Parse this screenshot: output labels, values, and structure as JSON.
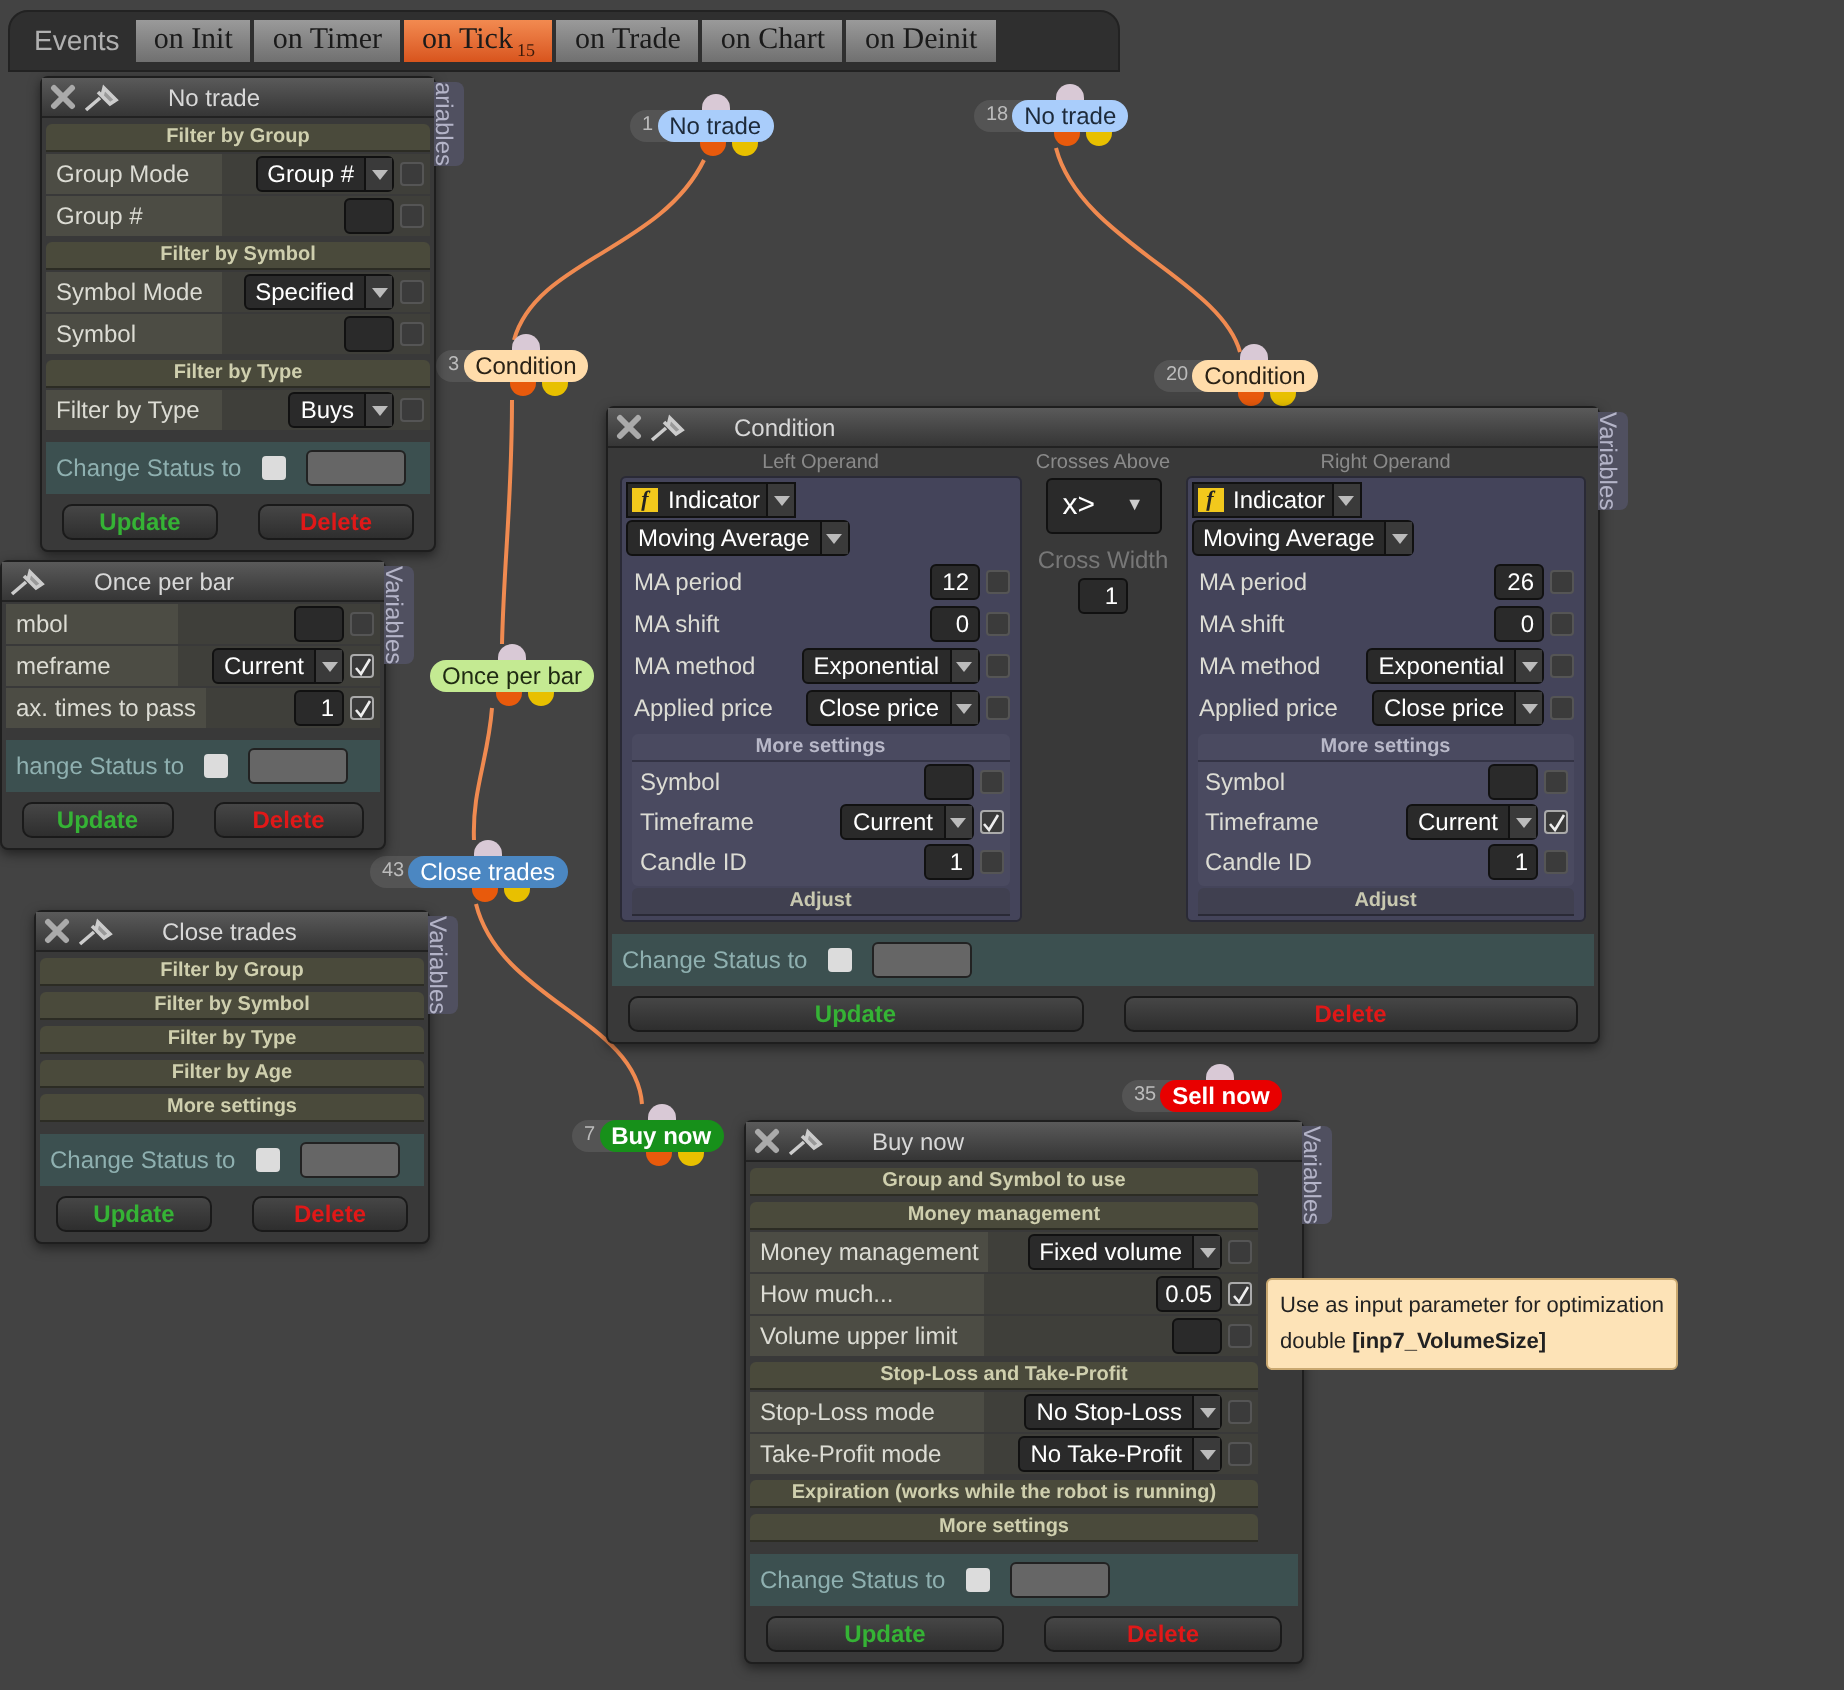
{
  "tab_bar": {
    "label": "Events",
    "tabs": [
      {
        "label": "on Init",
        "selected": false
      },
      {
        "label": "on Timer",
        "selected": false
      },
      {
        "label": "on Tick",
        "selected": true,
        "badge": "15"
      },
      {
        "label": "on Trade",
        "selected": false
      },
      {
        "label": "on Chart",
        "selected": false
      },
      {
        "label": "on Deinit",
        "selected": false
      }
    ]
  },
  "nodes": [
    {
      "number": "1",
      "label": "No trade",
      "kind": "no_trade"
    },
    {
      "number": "18",
      "label": "No trade",
      "kind": "no_trade"
    },
    {
      "number": "3",
      "label": "Condition",
      "kind": "condition"
    },
    {
      "number": "20",
      "label": "Condition",
      "kind": "condition"
    },
    {
      "label": "Once per bar",
      "kind": "once_per_bar"
    },
    {
      "number": "43",
      "label": "Close trades",
      "kind": "close_trades"
    },
    {
      "number": "7",
      "label": "Buy now",
      "kind": "buy"
    },
    {
      "number": "35",
      "label": "Sell now",
      "kind": "sell"
    }
  ],
  "panels": [
    {
      "kind": "form",
      "title": "No trade",
      "close_visible": true,
      "variables": "ariables",
      "rows": [
        {
          "kind": "section",
          "label": "Filter by Group"
        },
        {
          "kind": "select",
          "label": "Group Mode",
          "value": "Group #",
          "checked": false
        },
        {
          "kind": "input",
          "label": "Group #",
          "checked": false
        },
        {
          "kind": "section",
          "label": "Filter by Symbol"
        },
        {
          "kind": "select",
          "label": "Symbol Mode",
          "value": "Specified",
          "checked": false
        },
        {
          "kind": "input",
          "label": "Symbol",
          "checked": false
        },
        {
          "kind": "section",
          "label": "Filter by Type"
        },
        {
          "kind": "select",
          "label": "Filter by Type",
          "value": "Buys",
          "checked": false
        }
      ],
      "status_label": "Change Status to",
      "status_checked": false,
      "buttons": [
        {
          "label": "Update",
          "kind": "update"
        },
        {
          "label": "Delete",
          "kind": "delete"
        }
      ]
    },
    {
      "kind": "form",
      "title": "Once per bar",
      "close_visible": false,
      "variables": "Variables",
      "rows": [
        {
          "kind": "input",
          "label": "mbol",
          "checked": false
        },
        {
          "kind": "select",
          "label": "meframe",
          "value": "Current",
          "checked": true
        },
        {
          "kind": "input",
          "label": "ax. times to pass",
          "value": "1",
          "checked": true
        }
      ],
      "status_label": "hange Status to",
      "status_checked": false,
      "buttons": [
        {
          "label": "Update",
          "kind": "update"
        },
        {
          "label": "Delete",
          "kind": "delete"
        }
      ]
    },
    {
      "kind": "form",
      "title": "Close trades",
      "close_visible": true,
      "variables": "Variables",
      "rows": [
        {
          "kind": "section",
          "label": "Filter by Group"
        },
        {
          "kind": "section",
          "label": "Filter by Symbol"
        },
        {
          "kind": "section",
          "label": "Filter by Type"
        },
        {
          "kind": "section",
          "label": "Filter by Age"
        },
        {
          "kind": "section",
          "label": "More settings"
        }
      ],
      "status_label": "Change Status to",
      "status_checked": false,
      "buttons": [
        {
          "label": "Update",
          "kind": "update"
        },
        {
          "label": "Delete",
          "kind": "delete"
        }
      ]
    },
    {
      "kind": "condition",
      "title": "Condition",
      "close_visible": true,
      "variables": "Variables",
      "operands": [
        {
          "heading": "Left Operand",
          "badge": "f",
          "type": "Indicator",
          "indicator": "Moving Average",
          "rows": [
            {
              "kind": "input",
              "label": "MA period",
              "value": "12",
              "checked": false
            },
            {
              "kind": "input",
              "label": "MA shift",
              "value": "0",
              "checked": false
            },
            {
              "kind": "select",
              "label": "MA method",
              "value": "Exponential",
              "checked": false
            },
            {
              "kind": "select",
              "label": "Applied price",
              "value": "Close price",
              "checked": false
            }
          ],
          "more_settings": "More settings",
          "more_rows": [
            {
              "kind": "input",
              "label": "Symbol",
              "checked": false
            },
            {
              "kind": "select",
              "label": "Timeframe",
              "value": "Current",
              "checked": true
            },
            {
              "kind": "input",
              "label": "Candle ID",
              "value": "1",
              "checked": false
            }
          ],
          "adjust": "Adjust"
        },
        {
          "heading": "Right Operand",
          "badge": "f",
          "type": "Indicator",
          "indicator": "Moving Average",
          "rows": [
            {
              "kind": "input",
              "label": "MA period",
              "value": "26",
              "checked": false
            },
            {
              "kind": "input",
              "label": "MA shift",
              "value": "0",
              "checked": false
            },
            {
              "kind": "select",
              "label": "MA method",
              "value": "Exponential",
              "checked": false
            },
            {
              "kind": "select",
              "label": "Applied price",
              "value": "Close price",
              "checked": false
            }
          ],
          "more_settings": "More settings",
          "more_rows": [
            {
              "kind": "input",
              "label": "Symbol",
              "checked": false
            },
            {
              "kind": "select",
              "label": "Timeframe",
              "value": "Current",
              "checked": true
            },
            {
              "kind": "input",
              "label": "Candle ID",
              "value": "1",
              "checked": false
            }
          ],
          "adjust": "Adjust"
        }
      ],
      "operator": {
        "heading": "Crosses Above",
        "symbol": "x>",
        "caret": "▼",
        "width_label": "Cross Width",
        "width_value": "1"
      },
      "status_label": "Change Status to",
      "status_checked": false,
      "buttons": [
        {
          "label": "Update",
          "kind": "update"
        },
        {
          "label": "Delete",
          "kind": "delete"
        }
      ]
    },
    {
      "kind": "form",
      "title": "Buy now",
      "close_visible": true,
      "variables": "Variables",
      "rows": [
        {
          "kind": "section",
          "label": "Group and Symbol to use"
        },
        {
          "kind": "section",
          "label": "Money management"
        },
        {
          "kind": "select",
          "label": "Money management",
          "value": "Fixed volume",
          "checked": false
        },
        {
          "kind": "input",
          "label": "How much...",
          "value": "0.05",
          "checked": true
        },
        {
          "kind": "input",
          "label": "Volume upper limit",
          "checked": false
        },
        {
          "kind": "section",
          "label": "Stop-Loss and Take-Profit"
        },
        {
          "kind": "select",
          "label": "Stop-Loss mode",
          "value": "No Stop-Loss",
          "checked": false
        },
        {
          "kind": "select",
          "label": "Take-Profit mode",
          "value": "No Take-Profit",
          "checked": false
        },
        {
          "kind": "section",
          "label": "Expiration (works while the robot is running)"
        },
        {
          "kind": "section",
          "label": "More settings"
        }
      ],
      "status_label": "Change Status to",
      "status_checked": false,
      "buttons": [
        {
          "label": "Update",
          "kind": "update"
        },
        {
          "label": "Delete",
          "kind": "delete"
        }
      ]
    }
  ],
  "tooltip": {
    "lines": [
      "Use as input parameter for optimization",
      "double **[inp7_VolumeSize]**"
    ]
  }
}
